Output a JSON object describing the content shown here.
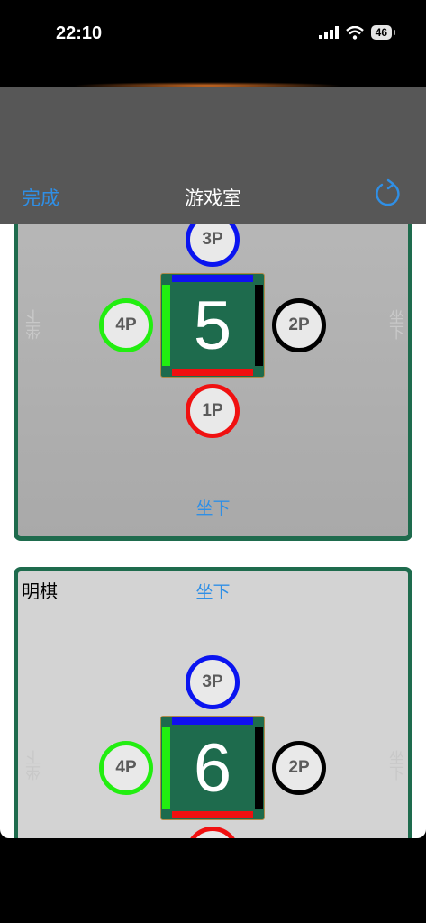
{
  "status": {
    "time": "22:10",
    "battery": "46"
  },
  "nav": {
    "done": "完成",
    "title": "游戏室",
    "refresh_icon": "refresh-icon"
  },
  "rooms": [
    {
      "table_number": "5",
      "seats": {
        "top": "3P",
        "left": "4P",
        "right": "2P",
        "bottom": "1P"
      },
      "left_side_label": "坐下",
      "right_side_label": "坐下",
      "sit_down": "坐下"
    },
    {
      "mode": "明棋",
      "sit_down": "坐下",
      "table_number": "6",
      "seats": {
        "top": "3P",
        "left": "4P",
        "right": "2P"
      },
      "left_side_label": "坐下",
      "right_side_label": "坐下"
    }
  ],
  "colors": {
    "accent": "#2f8fe6",
    "table": "#1e6b4d",
    "nav": "#575757"
  }
}
